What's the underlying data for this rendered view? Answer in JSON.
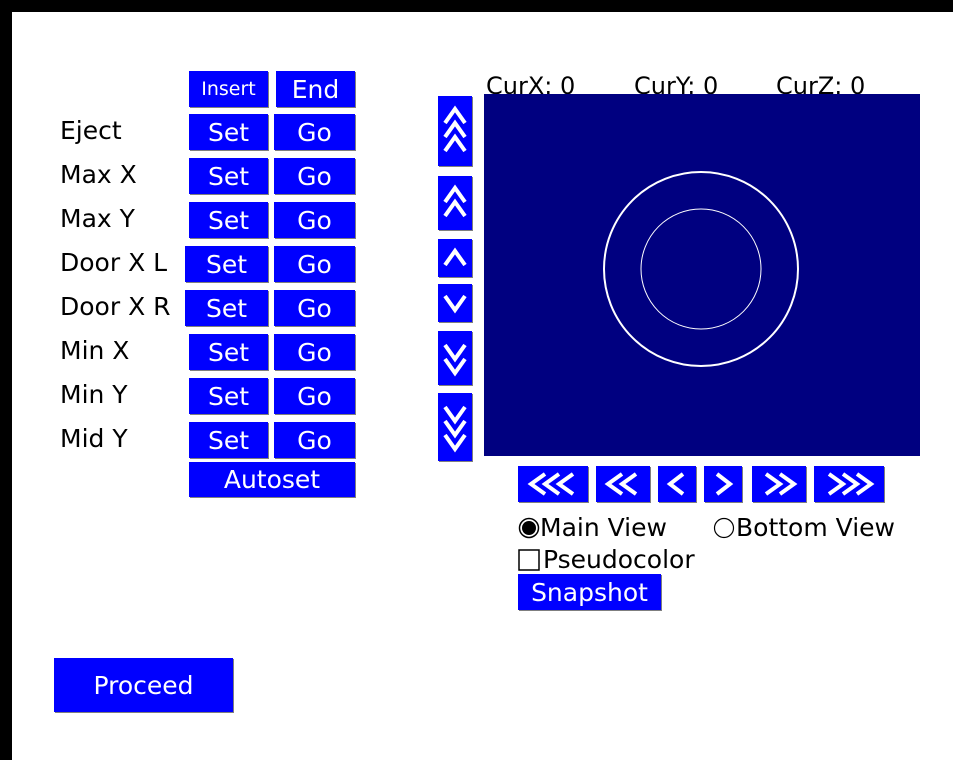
{
  "table": {
    "insert_label": "Insert",
    "end_label": "End",
    "rows": [
      {
        "label": "Eject",
        "set": "Set",
        "go": "Go"
      },
      {
        "label": "Max X",
        "set": "Set",
        "go": "Go"
      },
      {
        "label": "Max Y",
        "set": "Set",
        "go": "Go"
      },
      {
        "label": "Door X L",
        "set": "Set",
        "go": "Go"
      },
      {
        "label": "Door X R",
        "set": "Set",
        "go": "Go"
      },
      {
        "label": "Min X",
        "set": "Set",
        "go": "Go"
      },
      {
        "label": "Min Y",
        "set": "Set",
        "go": "Go"
      },
      {
        "label": "Mid Y",
        "set": "Set",
        "go": "Go"
      }
    ],
    "autoset_label": "Autoset"
  },
  "proceed_label": "Proceed",
  "coords": {
    "x": "CurX: 0",
    "y": "CurY: 0",
    "z": "CurZ: 0"
  },
  "view": {
    "background": "#000080",
    "options": {
      "main_view": "Main View",
      "bottom_view": "Bottom View",
      "selected": "main_view",
      "pseudocolor": "Pseudocolor",
      "pseudocolor_checked": false
    },
    "snapshot_label": "Snapshot"
  },
  "nav_icons": {
    "vertical": [
      "triple-up-icon",
      "double-up-icon",
      "up-icon",
      "down-icon",
      "double-down-icon",
      "triple-down-icon"
    ],
    "horizontal": [
      "triple-left-icon",
      "double-left-icon",
      "left-icon",
      "right-icon",
      "double-right-icon",
      "triple-right-icon"
    ]
  },
  "colors": {
    "button": "#0000ff",
    "view": "#000080",
    "button_text": "#ffffff"
  }
}
